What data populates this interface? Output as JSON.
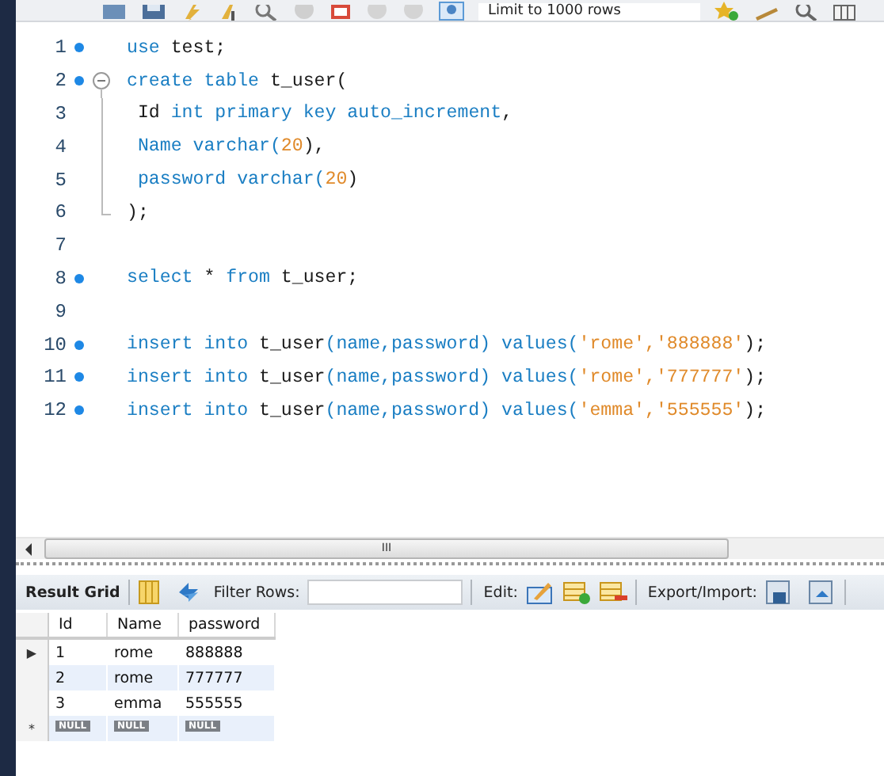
{
  "toolbar": {
    "limit": "Limit to 1000 rows"
  },
  "editor": {
    "lines": [
      {
        "number": "1",
        "dot": true,
        "fold_marker": false,
        "fold_guide": false,
        "tokens": [
          {
            "t": "use",
            "kind": "kw"
          },
          {
            "t": " test;",
            "kind": "plain"
          }
        ]
      },
      {
        "number": "2",
        "dot": true,
        "fold_marker": true,
        "fold_guide": false,
        "tokens": [
          {
            "t": "create table",
            "kind": "kw"
          },
          {
            "t": " t_user(",
            "kind": "plain"
          }
        ]
      },
      {
        "number": "3",
        "dot": false,
        "fold_marker": false,
        "fold_guide": true,
        "tokens": [
          {
            "t": " Id ",
            "kind": "plain"
          },
          {
            "t": "int primary key auto_increment",
            "kind": "kw"
          },
          {
            "t": ",",
            "kind": "plain"
          }
        ]
      },
      {
        "number": "4",
        "dot": false,
        "fold_marker": false,
        "fold_guide": true,
        "tokens": [
          {
            "t": " Name varchar(",
            "kind": "kw"
          },
          {
            "t": "20",
            "kind": "lit"
          },
          {
            "t": "),",
            "kind": "plain"
          }
        ]
      },
      {
        "number": "5",
        "dot": false,
        "fold_marker": false,
        "fold_guide": true,
        "tokens": [
          {
            "t": " password varchar(",
            "kind": "kw"
          },
          {
            "t": "20",
            "kind": "lit"
          },
          {
            "t": ")",
            "kind": "plain"
          }
        ]
      },
      {
        "number": "6",
        "dot": false,
        "fold_marker": false,
        "fold_guide": true,
        "tokens": [
          {
            "t": ");",
            "kind": "plain"
          }
        ]
      },
      {
        "number": "7",
        "dot": false,
        "fold_marker": false,
        "fold_guide": false
      },
      {
        "number": "8",
        "dot": true,
        "fold_marker": false,
        "fold_guide": false,
        "tokens": [
          {
            "t": "select",
            "kind": "kw"
          },
          {
            "t": " * ",
            "kind": "plain"
          },
          {
            "t": "from",
            "kind": "kw"
          },
          {
            "t": " t_user;",
            "kind": "plain"
          }
        ]
      },
      {
        "number": "9",
        "dot": false,
        "fold_marker": false,
        "fold_guide": false
      },
      {
        "number": "10",
        "dot": true,
        "fold_marker": false,
        "fold_guide": false,
        "tokens": [
          {
            "t": "insert into",
            "kind": "kw"
          },
          {
            "t": " t_user",
            "kind": "plain"
          },
          {
            "t": "(name,password) values(",
            "kind": "kw"
          },
          {
            "t": "'rome','888888'",
            "kind": "lit"
          },
          {
            "t": ");",
            "kind": "plain"
          }
        ]
      },
      {
        "number": "11",
        "dot": true,
        "fold_marker": false,
        "fold_guide": false,
        "tokens": [
          {
            "t": "insert into",
            "kind": "kw"
          },
          {
            "t": " t_user",
            "kind": "plain"
          },
          {
            "t": "(name,password) values(",
            "kind": "kw"
          },
          {
            "t": "'rome','777777'",
            "kind": "lit"
          },
          {
            "t": ");",
            "kind": "plain"
          }
        ]
      },
      {
        "number": "12",
        "dot": true,
        "fold_marker": false,
        "fold_guide": false,
        "tokens": [
          {
            "t": "insert into",
            "kind": "kw"
          },
          {
            "t": " t_user",
            "kind": "plain"
          },
          {
            "t": "(name,password) values(",
            "kind": "kw"
          },
          {
            "t": "'emma','555555'",
            "kind": "lit"
          },
          {
            "t": ");",
            "kind": "plain"
          }
        ]
      }
    ]
  },
  "scrollbar": {
    "grip": "III"
  },
  "result_toolbar": {
    "title": "Result Grid",
    "filter_label": "Filter Rows:",
    "edit_label": "Edit:",
    "export_label": "Export/Import:"
  },
  "grid": {
    "columns": [
      "Id",
      "Name",
      "password"
    ],
    "rows": [
      {
        "marker": "▶",
        "cells": [
          "1",
          "rome",
          "888888"
        ]
      },
      {
        "marker": "",
        "cells": [
          "2",
          "rome",
          "777777"
        ]
      },
      {
        "marker": "",
        "cells": [
          "3",
          "emma",
          "555555"
        ]
      }
    ],
    "new_row": {
      "marker": "*",
      "cells": [
        "NULL",
        "NULL",
        "NULL"
      ]
    }
  }
}
